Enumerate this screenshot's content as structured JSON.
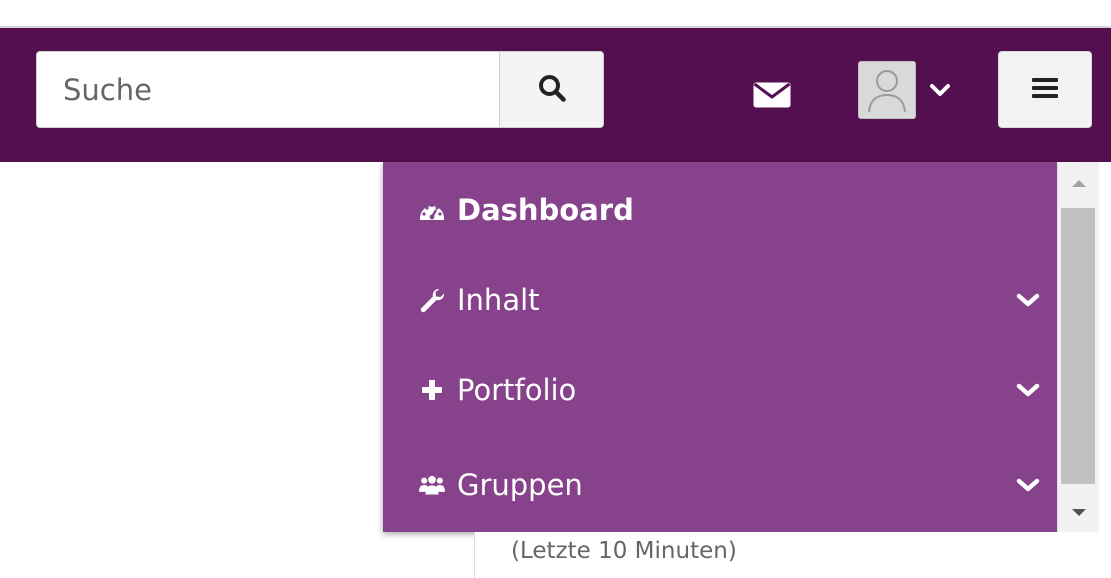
{
  "colors": {
    "header_bg": "#530f4f",
    "menu_bg": "#86428a",
    "menu_text": "#ffffff"
  },
  "search": {
    "placeholder": "Suche",
    "button_icon": "search-icon"
  },
  "header": {
    "mail_icon": "envelope-icon",
    "avatar_icon": "user-silhouette-icon",
    "user_menu_icon": "chevron-down-icon",
    "nav_toggle_icon": "hamburger-icon"
  },
  "menu": {
    "items": [
      {
        "label": "Dashboard",
        "icon": "tachometer-icon",
        "bold": true,
        "has_submenu": false
      },
      {
        "label": "Inhalt",
        "icon": "wrench-icon",
        "bold": false,
        "has_submenu": true
      },
      {
        "label": "Portfolio",
        "icon": "plus-icon",
        "bold": false,
        "has_submenu": true
      },
      {
        "label": "Gruppen",
        "icon": "users-icon",
        "bold": false,
        "has_submenu": true
      }
    ]
  },
  "side_panel": {
    "text": "(Letzte 10 Minuten)"
  }
}
